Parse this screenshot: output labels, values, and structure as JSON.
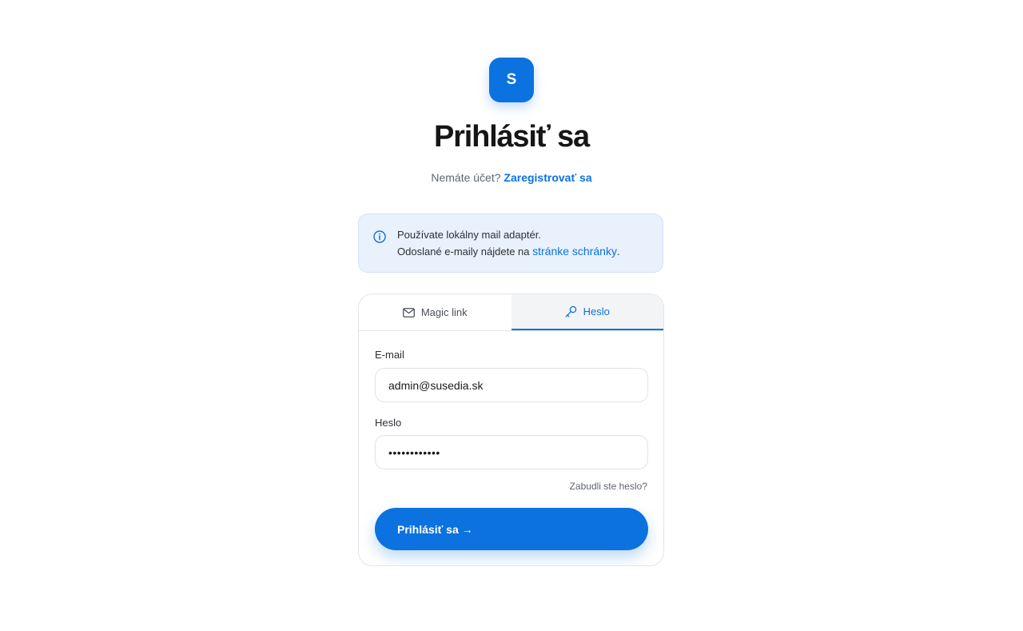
{
  "brand": {
    "logo_letter": "S",
    "accent": "#0b72e0"
  },
  "header": {
    "title": "Prihlásiť sa",
    "no_account_text": "Nemáte účet?",
    "register_link": "Zaregistrovať sa"
  },
  "notice": {
    "icon": "info-icon",
    "line1": "Používate lokálny mail adaptér.",
    "line2_prefix": "Odoslané e-maily nájdete na",
    "line2_link": "stránke schránky",
    "line2_suffix": "."
  },
  "tabs": [
    {
      "label": "Magic link",
      "icon": "mail-icon",
      "active": false
    },
    {
      "label": "Heslo",
      "icon": "key-icon",
      "active": true
    }
  ],
  "form": {
    "email_label": "E-mail",
    "email_value": "admin@susedia.sk",
    "password_label": "Heslo",
    "password_value": "••••••••••••",
    "forgot_link": "Zabudli ste heslo?",
    "submit_label": "Prihlásiť sa →"
  }
}
